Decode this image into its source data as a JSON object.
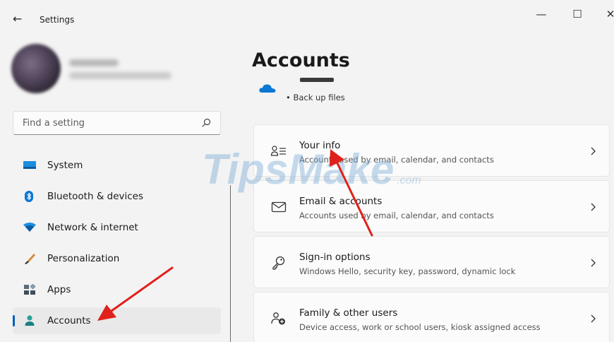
{
  "window": {
    "back_glyph": "←",
    "title": "Settings",
    "minimize_glyph": "—",
    "maximize_glyph": "☐",
    "close_glyph": "✕"
  },
  "search": {
    "placeholder": "Find a setting"
  },
  "sidebar": {
    "items": [
      {
        "label": "System",
        "icon": "system-icon",
        "active": false
      },
      {
        "label": "Bluetooth & devices",
        "icon": "bluetooth-icon",
        "active": false
      },
      {
        "label": "Network & internet",
        "icon": "wifi-icon",
        "active": false
      },
      {
        "label": "Personalization",
        "icon": "brush-icon",
        "active": false
      },
      {
        "label": "Apps",
        "icon": "apps-icon",
        "active": false
      },
      {
        "label": "Accounts",
        "icon": "person-icon",
        "active": true
      }
    ]
  },
  "main": {
    "title": "Accounts",
    "onedrive": {
      "backup_label": "• Back up files"
    },
    "cards": [
      {
        "title": "Your info",
        "desc": "Accounts used by email, calendar, and contacts",
        "icon": "your-info-icon"
      },
      {
        "title": "Email & accounts",
        "desc": "Accounts used by email, calendar, and contacts",
        "icon": "mail-icon"
      },
      {
        "title": "Sign-in options",
        "desc": "Windows Hello, security key, password, dynamic lock",
        "icon": "key-icon"
      },
      {
        "title": "Family & other users",
        "desc": "Device access, work or school users, kiosk assigned access",
        "icon": "family-icon"
      }
    ]
  },
  "watermark": {
    "brand": "TipsMake",
    "suffix": ".com"
  },
  "colors": {
    "accent": "#005fb8",
    "arrow": "#e0201b",
    "card_bg": "#fbfbfb",
    "window_bg": "#f3f3f3"
  }
}
